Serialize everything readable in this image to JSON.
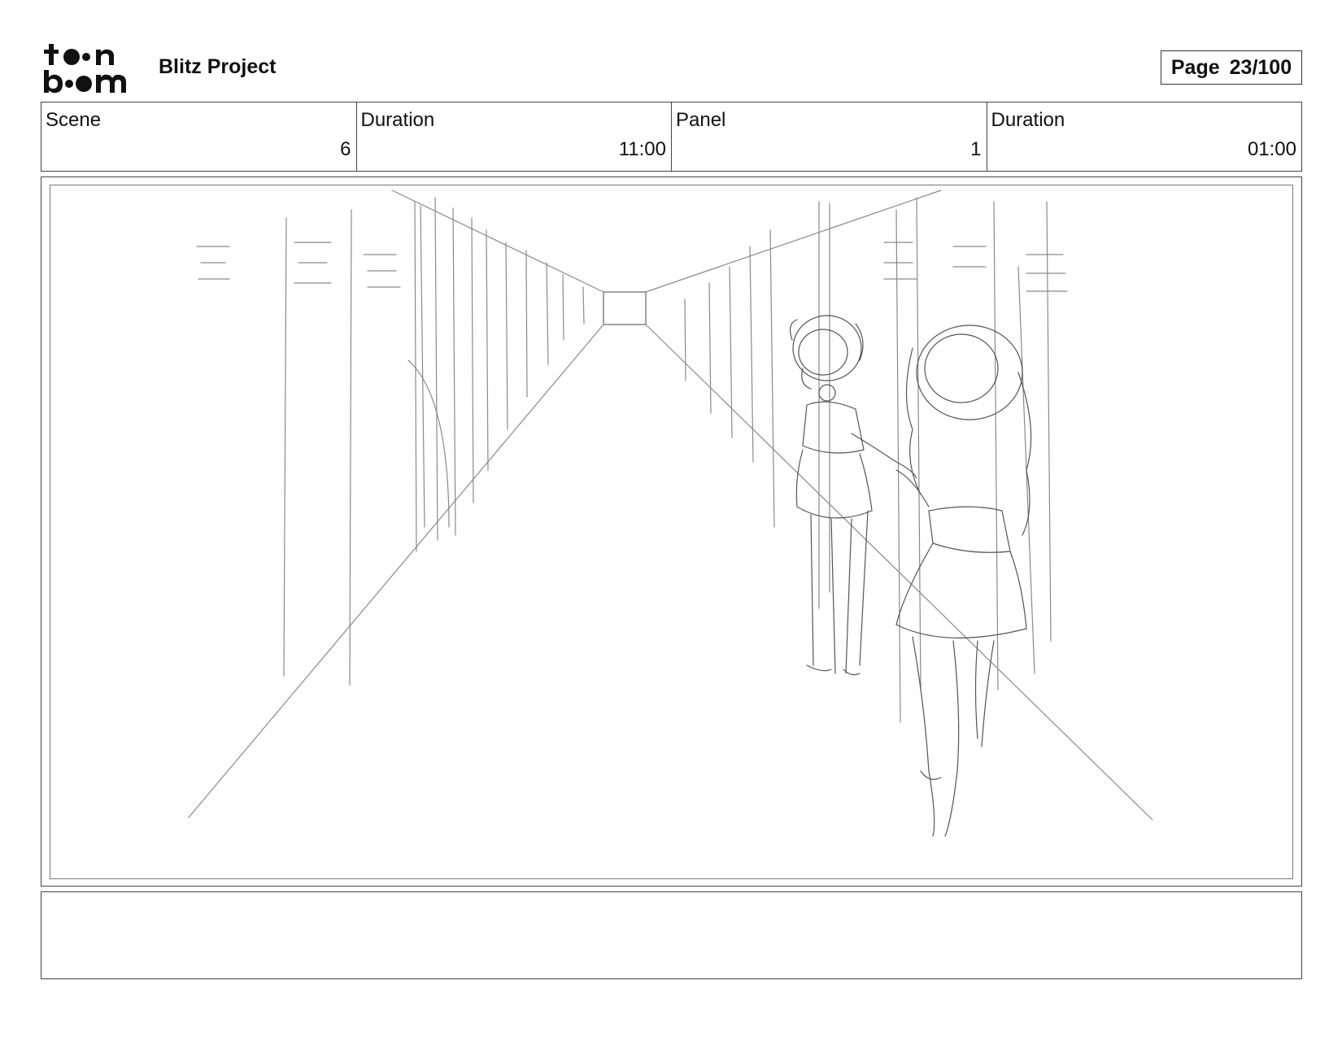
{
  "header": {
    "logo_text": "toon boom",
    "project_title": "Blitz Project",
    "page_label": "Page",
    "page_number": "23/100"
  },
  "info": [
    {
      "label": "Scene",
      "value": "6"
    },
    {
      "label": "Duration",
      "value": "11:00"
    },
    {
      "label": "Panel",
      "value": "1"
    },
    {
      "label": "Duration",
      "value": "01:00"
    }
  ],
  "panel": {
    "icon": "storyboard-sketch-corridor-two-girls",
    "stroke_color": "#8a8a8a"
  },
  "notes": {
    "text": ""
  }
}
